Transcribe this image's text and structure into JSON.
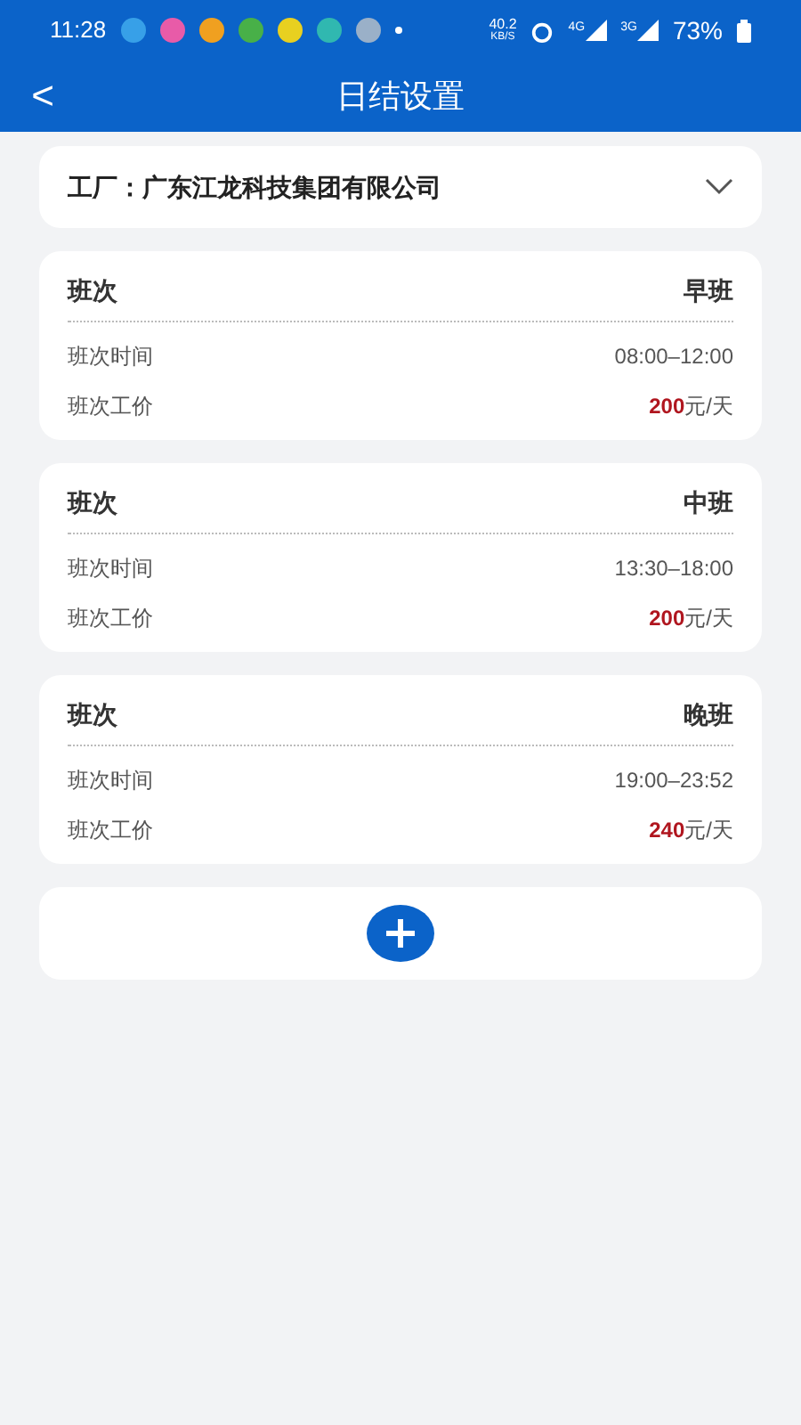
{
  "status_bar": {
    "time": "11:28",
    "speed": "40.2",
    "speed_unit": "KB/S",
    "network_1": "4G",
    "network_2": "3G",
    "battery": "73%"
  },
  "header": {
    "back": "<",
    "title": "日结设置"
  },
  "factory": {
    "label": "工厂：广东江龙科技集团有限公司"
  },
  "shifts": [
    {
      "title_label": "班次",
      "name": "早班",
      "time_label": "班次时间",
      "time": "08:00–12:00",
      "price_label": "班次工价",
      "amount": "200",
      "unit": "元/天"
    },
    {
      "title_label": "班次",
      "name": "中班",
      "time_label": "班次时间",
      "time": "13:30–18:00",
      "price_label": "班次工价",
      "amount": "200",
      "unit": "元/天"
    },
    {
      "title_label": "班次",
      "name": "晚班",
      "time_label": "班次时间",
      "time": "19:00–23:52",
      "price_label": "班次工价",
      "amount": "240",
      "unit": "元/天"
    }
  ]
}
